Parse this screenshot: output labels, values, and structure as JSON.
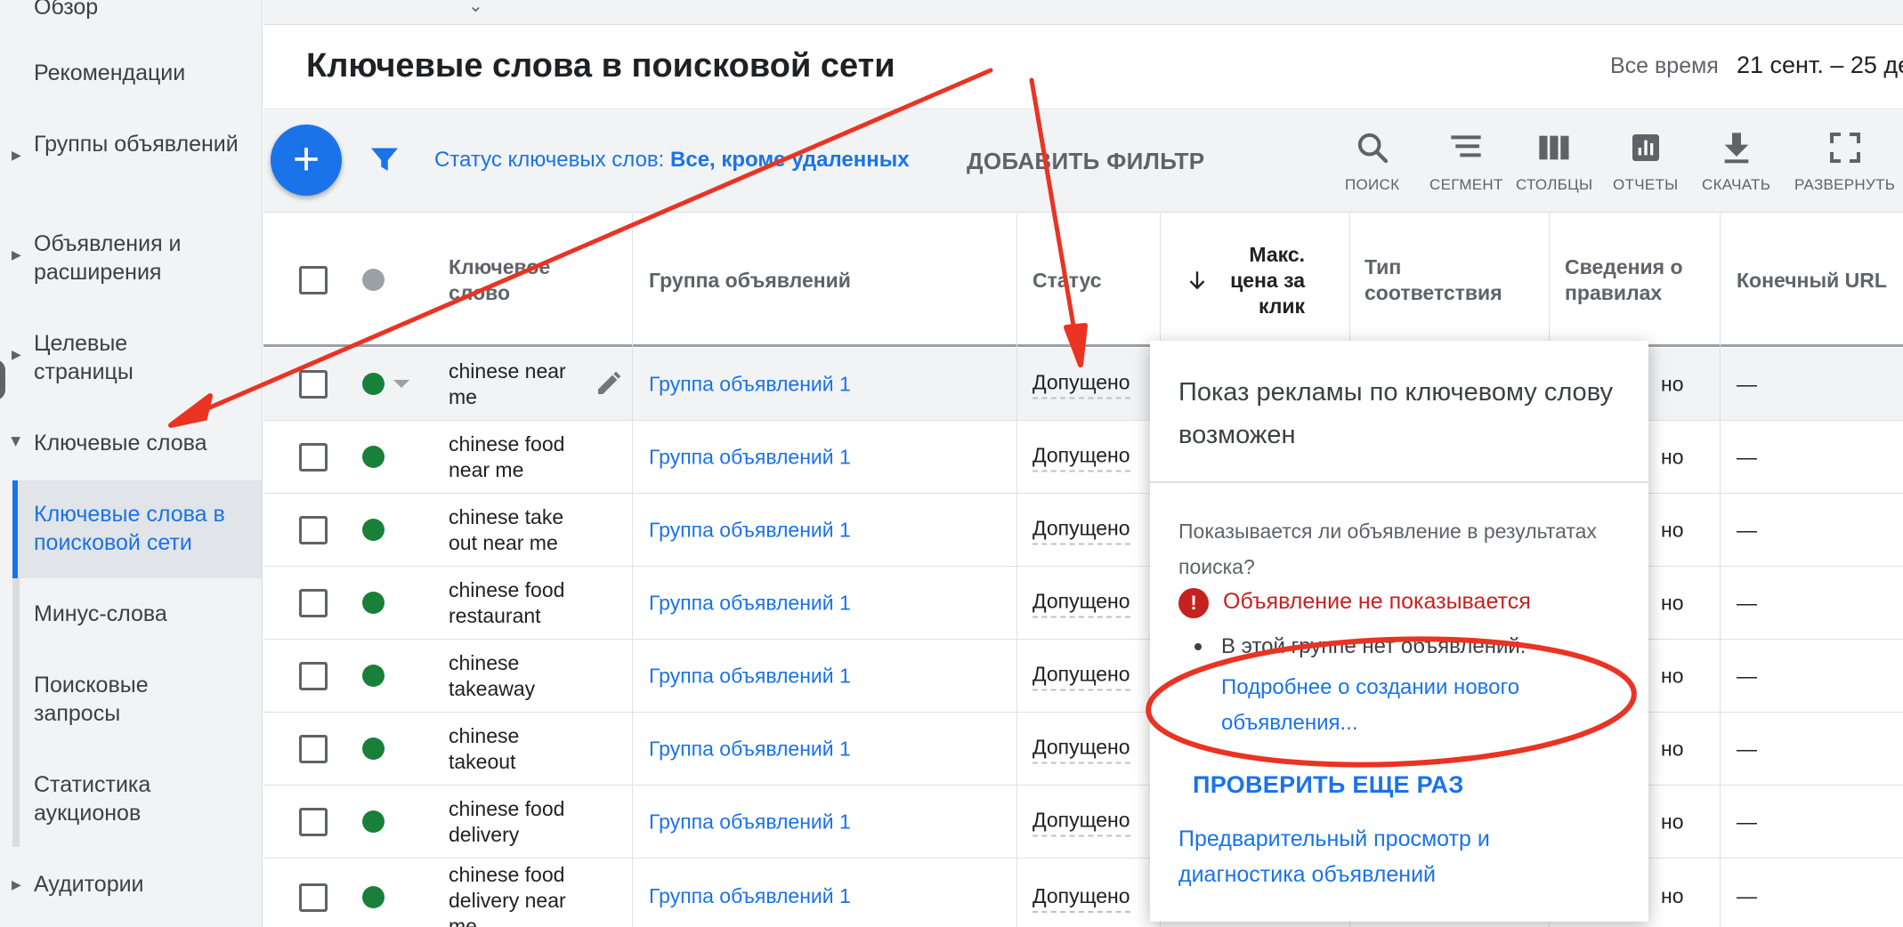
{
  "app": {
    "breadcrumb": "Обзор",
    "page_title": "Ключевые слова в поисковой сети",
    "date_range_label": "Все время",
    "date_range_value": "21 сент. – 25 де"
  },
  "sidebar": {
    "items": [
      {
        "label": "Обзор"
      },
      {
        "label": "Рекомендации"
      },
      {
        "label": "Группы объявлений"
      },
      {
        "label": "Объявления и расширения"
      },
      {
        "label": "Целевые страницы"
      },
      {
        "label": "Ключевые слова"
      },
      {
        "label": "Ключевые слова в поисковой сети"
      },
      {
        "label": "Минус-слова"
      },
      {
        "label": "Поисковые запросы"
      },
      {
        "label": "Статистика аукционов"
      },
      {
        "label": "Аудитории"
      }
    ]
  },
  "toolbar": {
    "add_button": "+",
    "filter_prefix": "Статус ключевых слов: ",
    "filter_value": "Все, кроме удаленных",
    "add_filter": "ДОБАВИТЬ ФИЛЬТР",
    "tools": [
      {
        "label": "ПОИСК",
        "icon": "search-icon"
      },
      {
        "label": "СЕГМЕНТ",
        "icon": "segment-icon"
      },
      {
        "label": "СТОЛБЦЫ",
        "icon": "columns-icon"
      },
      {
        "label": "ОТЧЕТЫ",
        "icon": "reports-icon"
      },
      {
        "label": "СКАЧАТЬ",
        "icon": "download-icon"
      },
      {
        "label": "РАЗВЕРНУТЬ",
        "icon": "expand-icon"
      }
    ]
  },
  "table": {
    "columns": {
      "keyword": "Ключевое слово",
      "ad_group": "Группа объявлений",
      "status": "Статус",
      "max_cpc": "Макс. цена за клик",
      "match_type": "Тип соответствия",
      "rules": "Сведения о правилах",
      "final_url": "Конечный URL"
    },
    "rows": [
      {
        "keyword": "chinese near me",
        "ad_group": "Группа объявлений 1",
        "status": "Допущено",
        "rules": "но",
        "url": "—"
      },
      {
        "keyword": "chinese food near me",
        "ad_group": "Группа объявлений 1",
        "status": "Допущено",
        "rules": "но",
        "url": "—"
      },
      {
        "keyword": "chinese take out near me",
        "ad_group": "Группа объявлений 1",
        "status": "Допущено",
        "rules": "но",
        "url": "—"
      },
      {
        "keyword": "chinese food restaurant",
        "ad_group": "Группа объявлений 1",
        "status": "Допущено",
        "rules": "но",
        "url": "—"
      },
      {
        "keyword": "chinese takeaway",
        "ad_group": "Группа объявлений 1",
        "status": "Допущено",
        "rules": "но",
        "url": "—"
      },
      {
        "keyword": "chinese takeout",
        "ad_group": "Группа объявлений 1",
        "status": "Допущено",
        "rules": "но",
        "url": "—"
      },
      {
        "keyword": "chinese food delivery",
        "ad_group": "Группа объявлений 1",
        "status": "Допущено",
        "rules": "но",
        "url": "—"
      },
      {
        "keyword": "chinese food delivery near me",
        "ad_group": "Группа объявлений 1",
        "status": "Допущено",
        "rules": "но",
        "url": "—"
      }
    ]
  },
  "popup": {
    "title": "Показ рекламы по ключевому слову возможен",
    "question": "Показывается ли объявление в результатах поиска?",
    "error_icon": "!",
    "error": "Объявление не показывается",
    "reason": "В этой группе нет объявлений.",
    "learn_more": "Подробнее о создании нового объявления...",
    "check_again": "ПРОВЕРИТЬ ЕЩЕ РАЗ",
    "preview": "Предварительный просмотр и диагностика объявлений"
  },
  "colors": {
    "accent": "#1a73e8",
    "status_ok": "#188038",
    "error": "#c5221f",
    "annotation": "#ea3323"
  }
}
